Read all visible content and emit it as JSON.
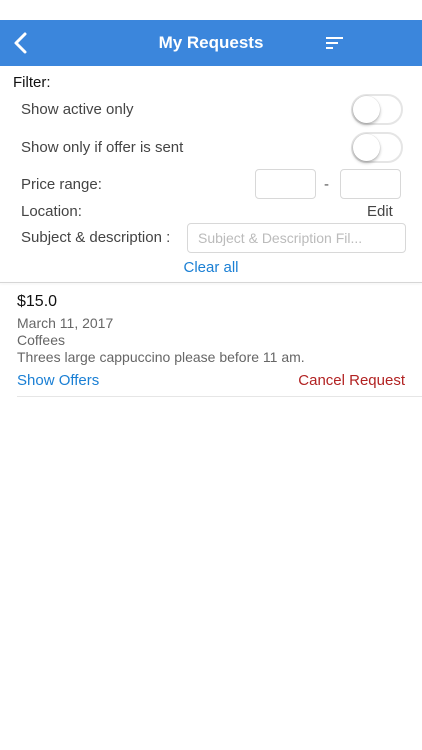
{
  "header": {
    "title": "My Requests",
    "background": "#3b86dc"
  },
  "filter": {
    "title": "Filter:",
    "show_active_label": "Show active only",
    "show_active_on": false,
    "show_offer_sent_label": "Show only if offer is sent",
    "show_offer_sent_on": false,
    "price_range_label": "Price range:",
    "price_min": "",
    "price_max": "",
    "price_separator": "-",
    "location_label": "Location:",
    "location_edit_label": "Edit",
    "subject_label": "Subject & description :",
    "subject_placeholder": "Subject & Description Fil...",
    "clear_all_label": "Clear all"
  },
  "requests": [
    {
      "price": "$15.0",
      "date": "March 11, 2017",
      "category": "Coffees",
      "description": "Threes large cappuccino please before 11 am.",
      "show_offers_label": "Show Offers",
      "cancel_label": "Cancel Request"
    }
  ],
  "colors": {
    "link_blue": "#1a7fd4",
    "cancel_red": "#b22222"
  }
}
